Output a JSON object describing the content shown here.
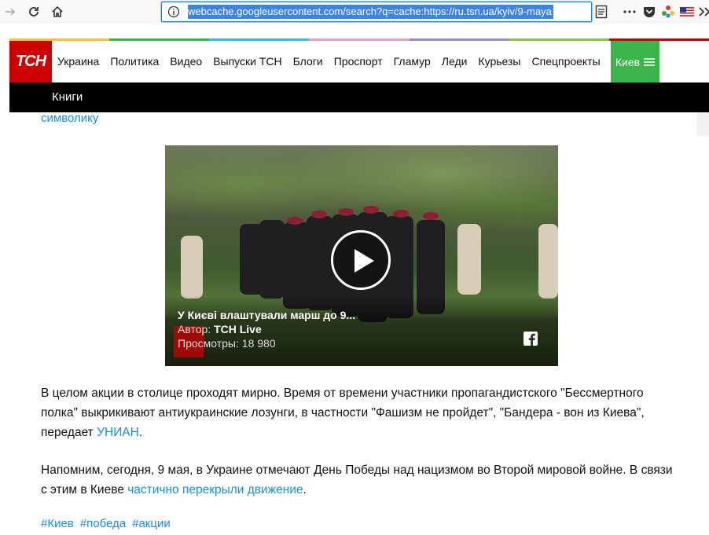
{
  "browser": {
    "url": "webcache.googleusercontent.com/search?q=cache:https://ru.tsn.ua/kyiv/9-maya"
  },
  "site": {
    "logo_text": "ТСН",
    "nav_items": [
      "Украина",
      "Политика",
      "Видео",
      "Выпуски ТСН",
      "Блоги",
      "Проспорт",
      "Гламур",
      "Леди",
      "Курьезы",
      "Спецпроекты"
    ],
    "region": "Киев",
    "sub_nav_item": "Книги",
    "accent_colors": [
      "#f4c141",
      "#39b54a",
      "#3fb6e8",
      "#e7a1c3",
      "#9a8dc7",
      "#8bc34a",
      "#c00000"
    ]
  },
  "article": {
    "link_fragment": "символику",
    "video": {
      "title": "У Києві влаштували марш до 9...",
      "author_label": "Автор:",
      "author": "ТСН Live",
      "views": "Просмотры: 18 980",
      "badge": "ТСН"
    },
    "para1_text": "В целом акции в столице проходят мирно. Время от времени участники пропагандистского \"Бессмертного полка\" выкрикивают антиукраинские лозунги, в частности \"Фашизм не пройдет\", \"Бандера - вон из Киева\", передает ",
    "para1_link": "УНИАН",
    "para1_end": ".",
    "para2_text": "Напомним, сегодня, 9 мая, в Украине отмечают День Победы над нацизмом во Второй мировой войне. В связи с этим в Киеве ",
    "para2_link": "частично перекрыли движение",
    "para2_end": ".",
    "tags": [
      "#Киев",
      "#победа",
      "#акции"
    ]
  }
}
